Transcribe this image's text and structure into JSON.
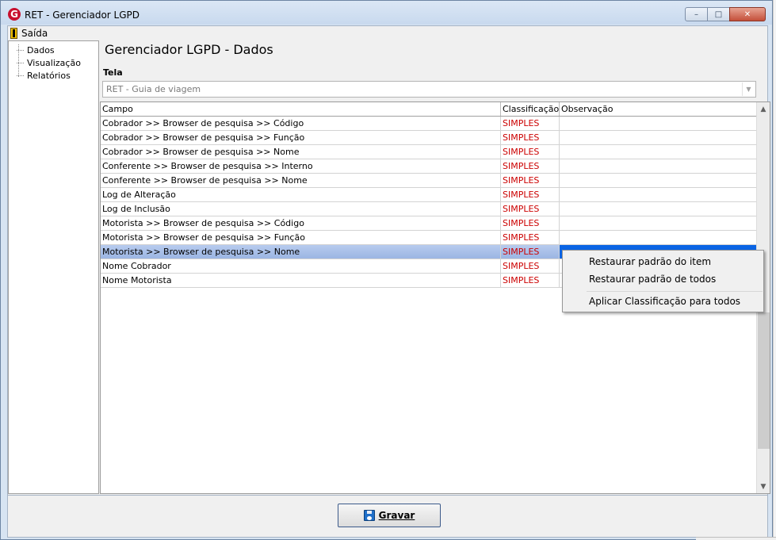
{
  "window": {
    "title": "RET - Gerenciador LGPD",
    "app_icon_letter": "G",
    "buttons": {
      "minimize": "–",
      "maximize": "□",
      "close": "✕"
    }
  },
  "menu": {
    "exit_label": "Saída"
  },
  "tree": {
    "items": [
      {
        "label": "Dados"
      },
      {
        "label": "Visualização"
      },
      {
        "label": "Relatórios"
      }
    ]
  },
  "main": {
    "heading": "Gerenciador LGPD - Dados",
    "tela_label": "Tela",
    "tela_value": "RET - Guia de viagem"
  },
  "grid": {
    "columns": [
      "Campo",
      "Classificação",
      "Observação"
    ],
    "rows": [
      {
        "campo": "Cobrador >> Browser de pesquisa >> Código",
        "classificacao": "SIMPLES",
        "observacao": ""
      },
      {
        "campo": "Cobrador >> Browser de pesquisa >> Função",
        "classificacao": "SIMPLES",
        "observacao": ""
      },
      {
        "campo": "Cobrador >> Browser de pesquisa >> Nome",
        "classificacao": "SIMPLES",
        "observacao": ""
      },
      {
        "campo": "Conferente >> Browser de pesquisa >> Interno",
        "classificacao": "SIMPLES",
        "observacao": ""
      },
      {
        "campo": "Conferente >> Browser de pesquisa >> Nome",
        "classificacao": "SIMPLES",
        "observacao": ""
      },
      {
        "campo": "Log de Alteração",
        "classificacao": "SIMPLES",
        "observacao": ""
      },
      {
        "campo": "Log de Inclusão",
        "classificacao": "SIMPLES",
        "observacao": ""
      },
      {
        "campo": "Motorista >> Browser de pesquisa >> Código",
        "classificacao": "SIMPLES",
        "observacao": ""
      },
      {
        "campo": "Motorista >> Browser de pesquisa >> Função",
        "classificacao": "SIMPLES",
        "observacao": ""
      },
      {
        "campo": "Motorista >> Browser de pesquisa >> Nome",
        "classificacao": "SIMPLES",
        "observacao": "",
        "selected": true
      },
      {
        "campo": "Nome Cobrador",
        "classificacao": "SIMPLES",
        "observacao": ""
      },
      {
        "campo": "Nome Motorista",
        "classificacao": "SIMPLES",
        "observacao": ""
      }
    ]
  },
  "context_menu": {
    "items": [
      "Restaurar padrão do item",
      "Restaurar padrão de todos",
      "Aplicar Classificação para todos"
    ]
  },
  "footer": {
    "save_label": "Gravar"
  },
  "colors": {
    "classification_text": "#cc0000",
    "selected_row": "#9bb5e3",
    "selected_cell": "#0a64e4"
  }
}
